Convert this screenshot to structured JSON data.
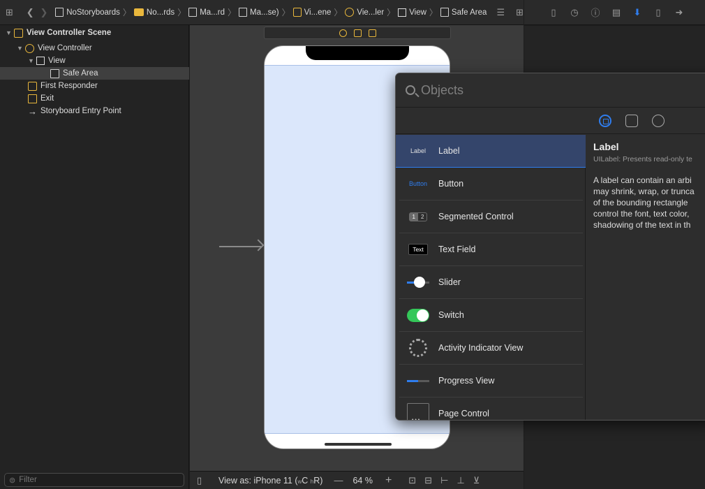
{
  "breadcrumb": {
    "items": [
      {
        "label": "NoStoryboards",
        "icon": "xcode-project-icon"
      },
      {
        "label": "No...rds",
        "icon": "folder-icon"
      },
      {
        "label": "Ma...rd",
        "icon": "file-icon"
      },
      {
        "label": "Ma...se)",
        "icon": "file-icon"
      },
      {
        "label": "Vi...ene",
        "icon": "scene-icon"
      },
      {
        "label": "Vie...ler",
        "icon": "view-controller-icon"
      },
      {
        "label": "View",
        "icon": "view-icon"
      },
      {
        "label": "Safe Area",
        "icon": "safe-area-icon"
      }
    ]
  },
  "outline": {
    "items": [
      {
        "label": "View Controller Scene",
        "level": 0
      },
      {
        "label": "View Controller",
        "level": 1
      },
      {
        "label": "View",
        "level": 2
      },
      {
        "label": "Safe Area",
        "level": 3,
        "selected": true
      },
      {
        "label": "First Responder",
        "level": 1
      },
      {
        "label": "Exit",
        "level": 1
      },
      {
        "label": "Storyboard Entry Point",
        "level": 1
      }
    ],
    "filter_placeholder": "Filter"
  },
  "canvas_toolbar": {
    "view_as_prefix": "View as: iPhone 11 (",
    "size_w": "w",
    "class_w": "C",
    "size_h": "h",
    "class_h": "R",
    "view_as_suffix": ")",
    "zoom_out": "—",
    "zoom": "64 %",
    "zoom_in": "+"
  },
  "library": {
    "search_placeholder": "Objects",
    "items": [
      {
        "name": "Label",
        "thumb": "Label",
        "selected": true
      },
      {
        "name": "Button",
        "thumb": "Button"
      },
      {
        "name": "Segmented Control",
        "thumb": "1 2"
      },
      {
        "name": "Text Field",
        "thumb": "Text"
      },
      {
        "name": "Slider",
        "thumb": ""
      },
      {
        "name": "Switch",
        "thumb": ""
      },
      {
        "name": "Activity Indicator View",
        "thumb": ""
      },
      {
        "name": "Progress View",
        "thumb": ""
      },
      {
        "name": "Page Control",
        "thumb": ""
      }
    ],
    "segmented_thumb": {
      "seg1": "1",
      "seg2": "2"
    },
    "detail": {
      "title": "Label",
      "subtitle": "UILabel: Presents read-only te",
      "lines": [
        "A label can contain an arbi",
        "may shrink, wrap, or trunca",
        "of the bounding rectangle",
        "control the font, text color,",
        "shadowing of the text in th"
      ]
    }
  },
  "colors": {
    "accent": "#2f7dee",
    "storyboard_yellow": "#e9b73c",
    "safe_area_fill": "#dbe7fb",
    "switch_green": "#34c759"
  }
}
